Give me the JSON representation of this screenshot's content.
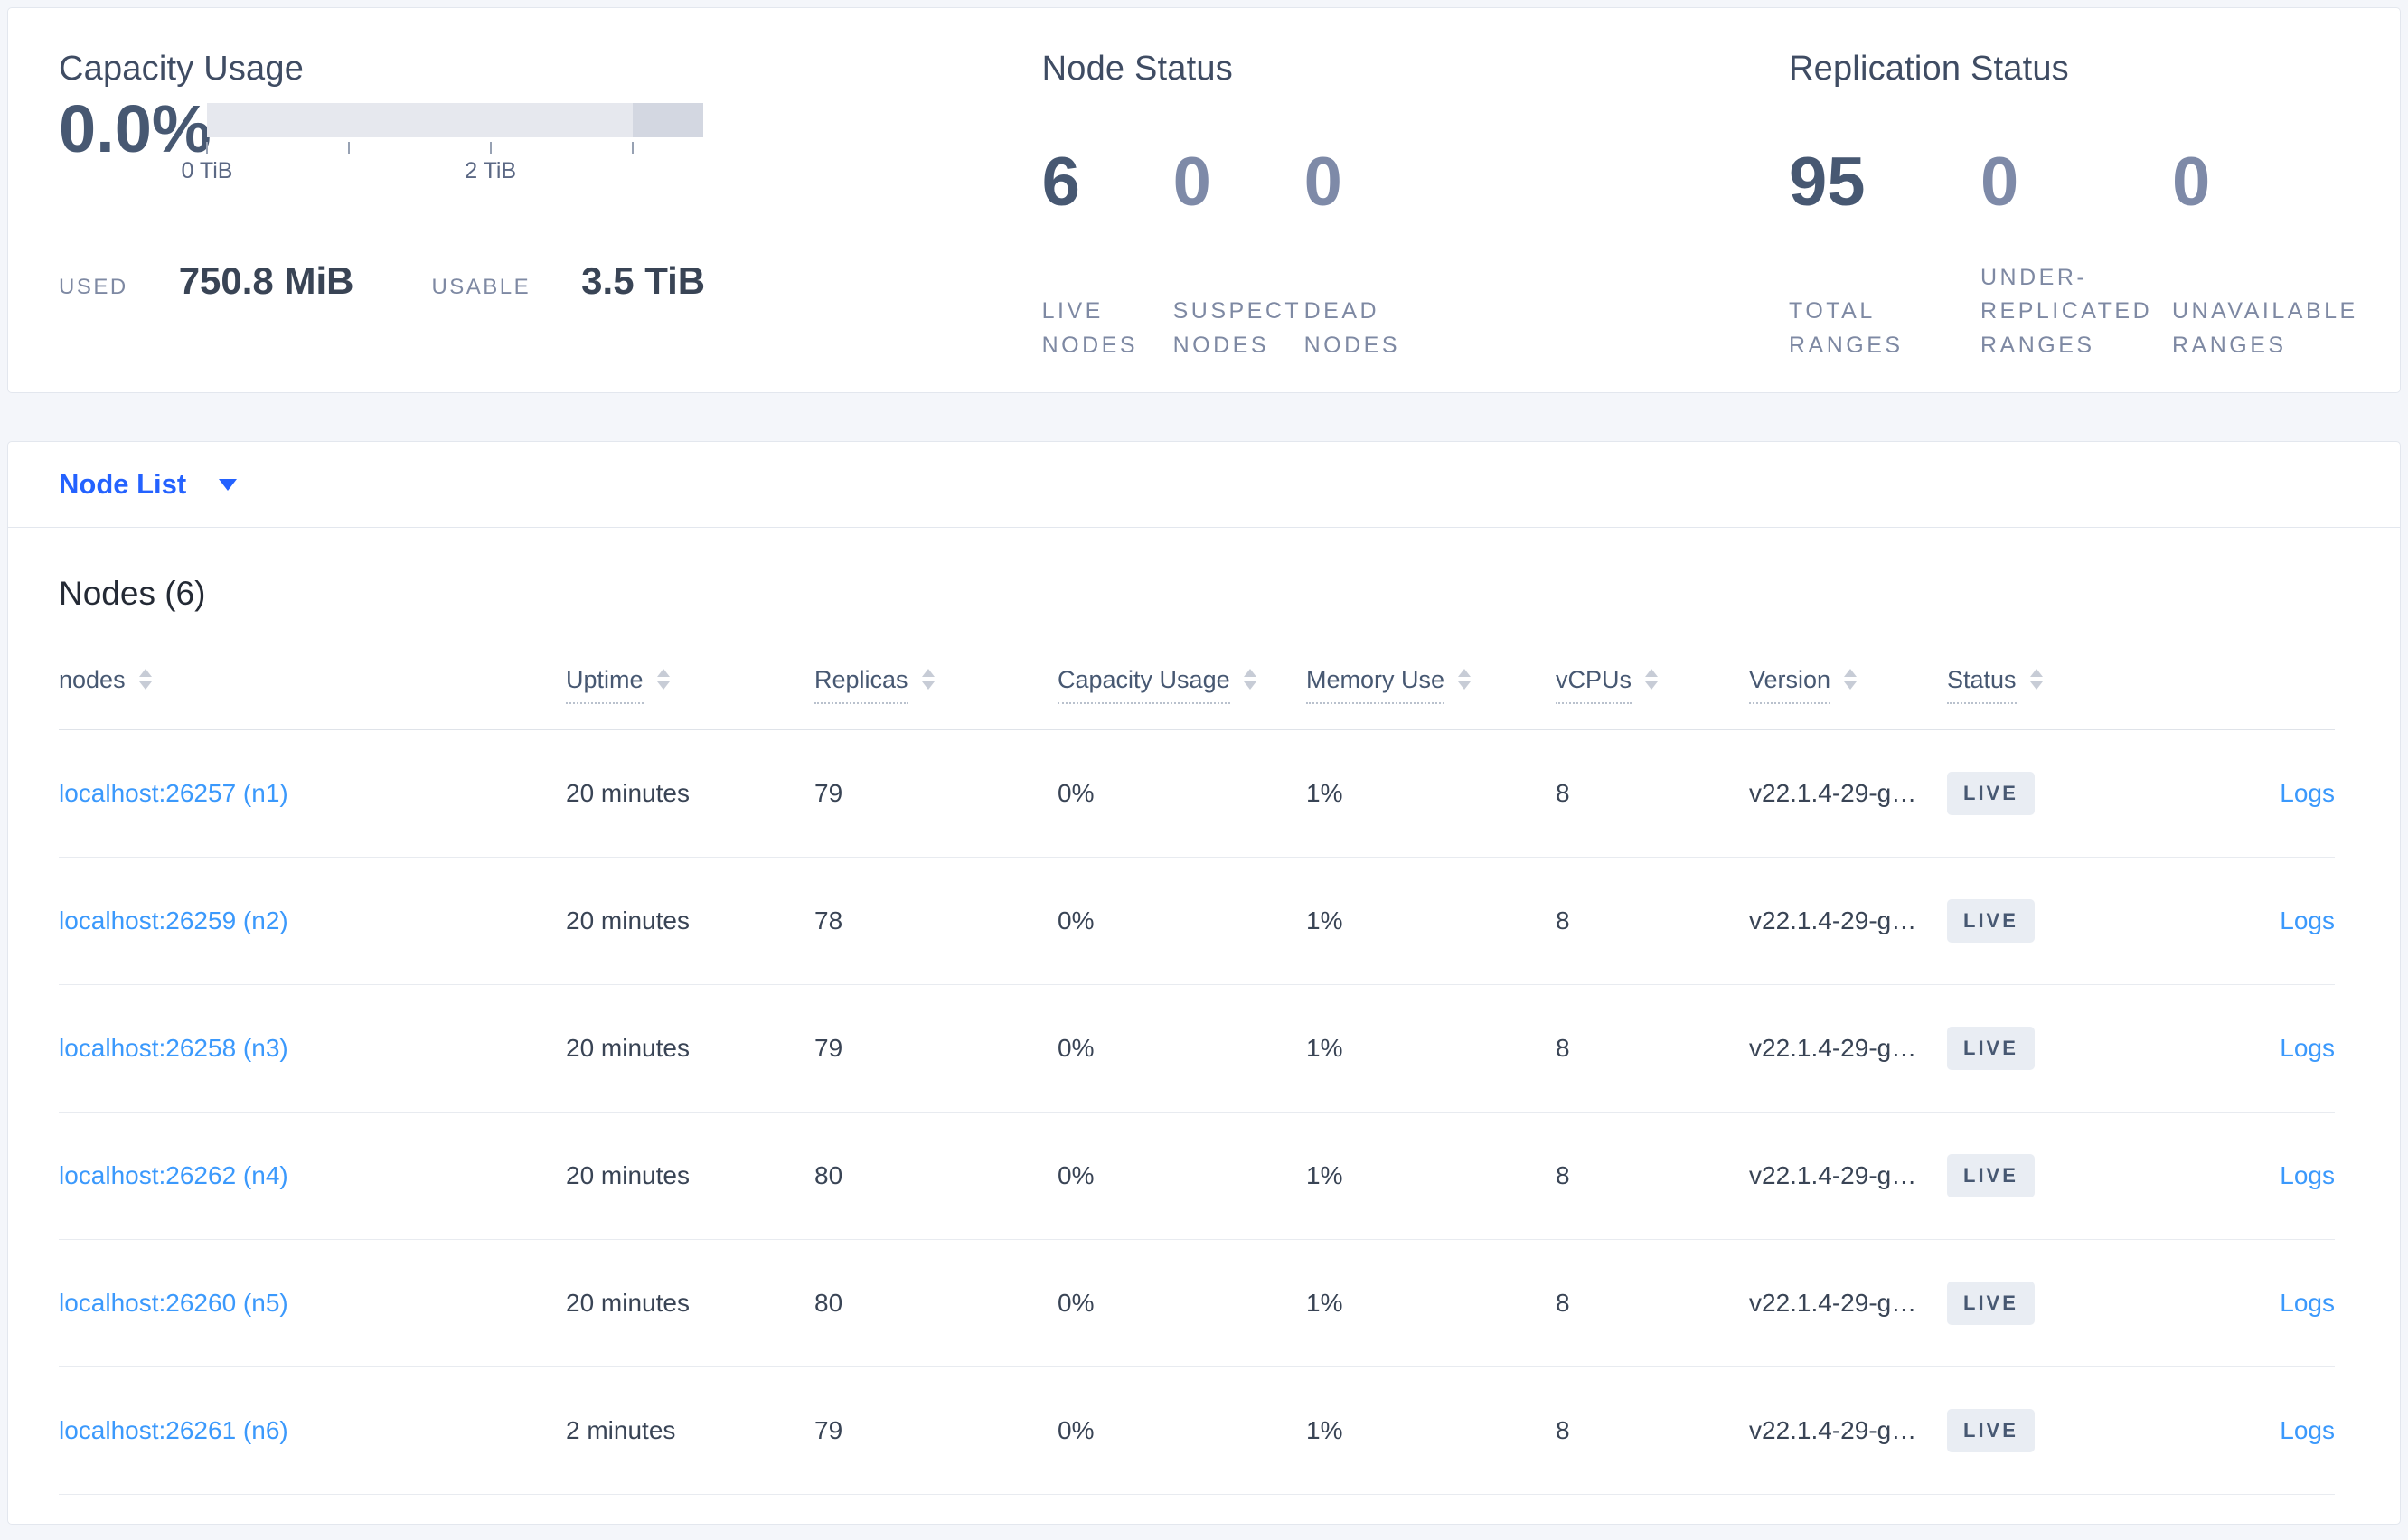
{
  "colors": {
    "link": "#3b99fc",
    "selector": "#2462ff",
    "slate": "#475872",
    "badge-bg": "#e9edf3",
    "bar-light": "#e6e8ee",
    "bar-dark": "#d3d7e1",
    "page-bg": "#f4f6fa"
  },
  "capacity_card": {
    "title": "Capacity Usage",
    "percent": "0.0%",
    "bar_segments": [
      {
        "width_pct": 85.71,
        "color": "#e6e8ee"
      },
      {
        "width_pct": 14.29,
        "color": "#d3d7e1"
      }
    ],
    "axis_ticks": [
      {
        "pos": 0,
        "label": "0 TiB"
      },
      {
        "pos": 28.57,
        "label": ""
      },
      {
        "pos": 57.14,
        "label": "2 TiB"
      },
      {
        "pos": 85.71,
        "label": ""
      }
    ],
    "used_label": "USED",
    "used_value": "750.8 MiB",
    "usable_label": "USABLE",
    "usable_value": "3.5 TiB"
  },
  "node_status_card": {
    "title": "Node Status",
    "stats": [
      {
        "value": "6",
        "label": "LIVE NODES",
        "primary": true
      },
      {
        "value": "0",
        "label": "SUSPECT NODES",
        "primary": false
      },
      {
        "value": "0",
        "label": "DEAD NODES",
        "primary": false
      }
    ]
  },
  "replication_card": {
    "title": "Replication Status",
    "stats": [
      {
        "value": "95",
        "label": "TOTAL RANGES",
        "primary": true
      },
      {
        "value": "0",
        "label": "UNDER-REPLICATED RANGES",
        "primary": false
      },
      {
        "value": "0",
        "label": "UNAVAILABLE RANGES",
        "primary": false
      }
    ]
  },
  "view_selector": {
    "label": "Node List",
    "icon": "caret-down-icon"
  },
  "nodes_section": {
    "title": "Nodes (6)",
    "columns": [
      {
        "key": "address",
        "label": "nodes",
        "sortable": true,
        "underline": false,
        "align": "left"
      },
      {
        "key": "uptime",
        "label": "Uptime",
        "sortable": true,
        "underline": true,
        "align": "left"
      },
      {
        "key": "replicas",
        "label": "Replicas",
        "sortable": true,
        "underline": true,
        "align": "left"
      },
      {
        "key": "capacity_usage",
        "label": "Capacity Usage",
        "sortable": true,
        "underline": true,
        "align": "left"
      },
      {
        "key": "memory_use",
        "label": "Memory Use",
        "sortable": true,
        "underline": true,
        "align": "left"
      },
      {
        "key": "vcpus",
        "label": "vCPUs",
        "sortable": true,
        "underline": true,
        "align": "left"
      },
      {
        "key": "version",
        "label": "Version",
        "sortable": true,
        "underline": true,
        "align": "left"
      },
      {
        "key": "status",
        "label": "Status",
        "sortable": true,
        "underline": true,
        "align": "left"
      },
      {
        "key": "logs",
        "label": "",
        "sortable": false,
        "underline": false,
        "align": "right"
      }
    ],
    "rows": [
      {
        "address": "localhost:26257 (n1)",
        "uptime": "20 minutes",
        "replicas": "79",
        "capacity_usage": "0%",
        "memory_use": "1%",
        "vcpus": "8",
        "version": "v22.1.4-29-g…",
        "status": "LIVE",
        "logs_label": "Logs"
      },
      {
        "address": "localhost:26259 (n2)",
        "uptime": "20 minutes",
        "replicas": "78",
        "capacity_usage": "0%",
        "memory_use": "1%",
        "vcpus": "8",
        "version": "v22.1.4-29-g…",
        "status": "LIVE",
        "logs_label": "Logs"
      },
      {
        "address": "localhost:26258 (n3)",
        "uptime": "20 minutes",
        "replicas": "79",
        "capacity_usage": "0%",
        "memory_use": "1%",
        "vcpus": "8",
        "version": "v22.1.4-29-g…",
        "status": "LIVE",
        "logs_label": "Logs"
      },
      {
        "address": "localhost:26262 (n4)",
        "uptime": "20 minutes",
        "replicas": "80",
        "capacity_usage": "0%",
        "memory_use": "1%",
        "vcpus": "8",
        "version": "v22.1.4-29-g…",
        "status": "LIVE",
        "logs_label": "Logs"
      },
      {
        "address": "localhost:26260 (n5)",
        "uptime": "20 minutes",
        "replicas": "80",
        "capacity_usage": "0%",
        "memory_use": "1%",
        "vcpus": "8",
        "version": "v22.1.4-29-g…",
        "status": "LIVE",
        "logs_label": "Logs"
      },
      {
        "address": "localhost:26261 (n6)",
        "uptime": "2 minutes",
        "replicas": "79",
        "capacity_usage": "0%",
        "memory_use": "1%",
        "vcpus": "8",
        "version": "v22.1.4-29-g…",
        "status": "LIVE",
        "logs_label": "Logs"
      }
    ]
  }
}
